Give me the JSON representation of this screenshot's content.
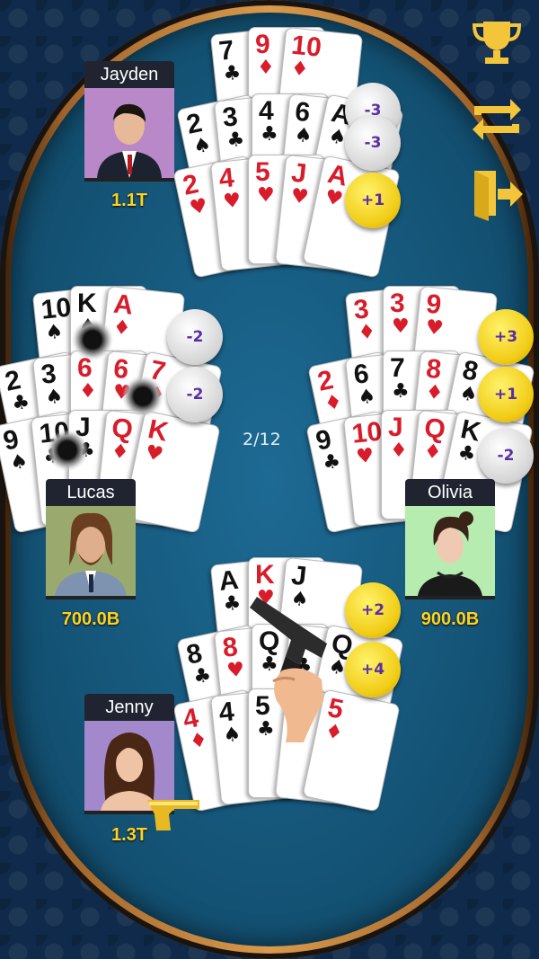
{
  "round_counter": "2/12",
  "players": {
    "top": {
      "name": "Jayden",
      "money": "1.1T"
    },
    "left": {
      "name": "Lucas",
      "money": "700.0B"
    },
    "right": {
      "name": "Olivia",
      "money": "900.0B"
    },
    "bottom": {
      "name": "Jenny",
      "money": "1.3T"
    }
  },
  "hands": {
    "top": [
      {
        "rank": "7",
        "suit": "♣"
      },
      {
        "rank": "9",
        "suit": "♦"
      },
      {
        "rank": "10",
        "suit": "♦"
      },
      {
        "rank": "2",
        "suit": "♠"
      },
      {
        "rank": "3",
        "suit": "♣"
      },
      {
        "rank": "4",
        "suit": "♣"
      },
      {
        "rank": "6",
        "suit": "♠"
      },
      {
        "rank": "A",
        "suit": "♠"
      },
      {
        "rank": "2",
        "suit": "♥"
      },
      {
        "rank": "4",
        "suit": "♥"
      },
      {
        "rank": "5",
        "suit": "♥"
      },
      {
        "rank": "J",
        "suit": "♥"
      },
      {
        "rank": "A",
        "suit": "♥"
      }
    ],
    "left": [
      {
        "rank": "10",
        "suit": "♠"
      },
      {
        "rank": "K",
        "suit": "♠"
      },
      {
        "rank": "A",
        "suit": "♦"
      },
      {
        "rank": "2",
        "suit": "♣"
      },
      {
        "rank": "3",
        "suit": "♠"
      },
      {
        "rank": "6",
        "suit": "♦"
      },
      {
        "rank": "6",
        "suit": "♥"
      },
      {
        "rank": "7",
        "suit": "♦"
      },
      {
        "rank": "9",
        "suit": "♠"
      },
      {
        "rank": "10",
        "suit": "♣"
      },
      {
        "rank": "J",
        "suit": "♣"
      },
      {
        "rank": "Q",
        "suit": "♦"
      },
      {
        "rank": "K",
        "suit": "♥"
      }
    ],
    "right": [
      {
        "rank": "3",
        "suit": "♦"
      },
      {
        "rank": "3",
        "suit": "♥"
      },
      {
        "rank": "9",
        "suit": "♥"
      },
      {
        "rank": "2",
        "suit": "♦"
      },
      {
        "rank": "6",
        "suit": "♠"
      },
      {
        "rank": "7",
        "suit": "♣"
      },
      {
        "rank": "8",
        "suit": "♦"
      },
      {
        "rank": "8",
        "suit": "♠"
      },
      {
        "rank": "9",
        "suit": "♣"
      },
      {
        "rank": "10",
        "suit": "♥"
      },
      {
        "rank": "J",
        "suit": "♦"
      },
      {
        "rank": "Q",
        "suit": "♦"
      },
      {
        "rank": "K",
        "suit": "♣"
      }
    ],
    "bottom": [
      {
        "rank": "A",
        "suit": "♣"
      },
      {
        "rank": "K",
        "suit": "♥"
      },
      {
        "rank": "J",
        "suit": "♠"
      },
      {
        "rank": "8",
        "suit": "♣"
      },
      {
        "rank": "8",
        "suit": "♥"
      },
      {
        "rank": "Q",
        "suit": "♣"
      },
      {
        "rank": "7",
        "suit": "♣"
      },
      {
        "rank": "Q",
        "suit": "♠"
      },
      {
        "rank": "4",
        "suit": "♦"
      },
      {
        "rank": "4",
        "suit": "♠"
      },
      {
        "rank": "5",
        "suit": "♣"
      },
      {
        "rank": "5",
        "suit": "♦"
      },
      {
        "rank": "5",
        "suit": "♦"
      }
    ]
  },
  "scores": {
    "top": [
      "-3",
      "-3",
      "+1"
    ],
    "left": [
      "-2",
      "-2"
    ],
    "right": [
      "+3",
      "+1",
      "-2"
    ],
    "bottom": [
      "+2",
      "+4"
    ]
  },
  "toolbar": {
    "trophy_icon": "trophy-icon",
    "swap_icon": "swap-arrows-icon",
    "exit_icon": "exit-door-icon"
  },
  "colors": {
    "felt": "#155679",
    "gold": "#ffd21f",
    "chip_text": "#5a2ea3"
  }
}
